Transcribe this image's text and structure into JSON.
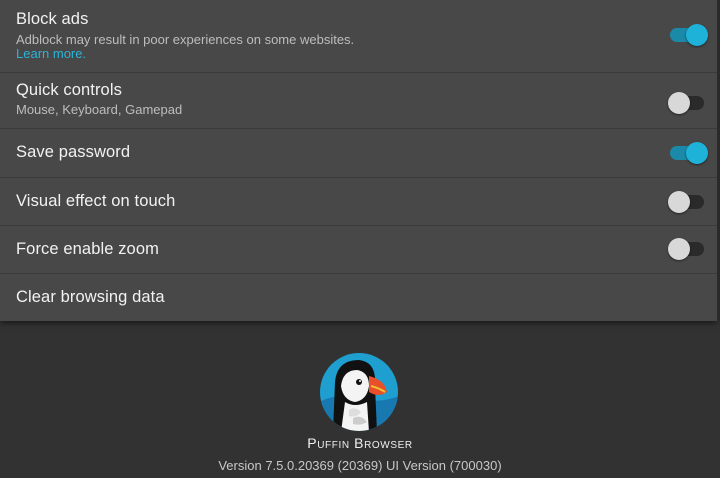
{
  "settings": {
    "block_ads": {
      "title": "Block ads",
      "subtitle": "Adblock may result in poor experiences on some websites.",
      "link": "Learn more.",
      "enabled": true
    },
    "quick_controls": {
      "title": "Quick controls",
      "subtitle": "Mouse, Keyboard, Gamepad",
      "enabled": false
    },
    "save_password": {
      "title": "Save password",
      "enabled": true
    },
    "visual_effect": {
      "title": "Visual effect on touch",
      "enabled": false
    },
    "force_zoom": {
      "title": "Force enable zoom",
      "enabled": false
    },
    "clear_data": {
      "title": "Clear browsing data"
    }
  },
  "about": {
    "app_name": "Puffin Browser",
    "version": "Version 7.5.0.20369 (20369) UI Version (700030)",
    "logo_icon": "puffin-bird-logo"
  },
  "colors": {
    "accent": "#1fb2d8",
    "link": "#2bb4d8",
    "panel_bg": "#484848",
    "page_bg": "#323232"
  }
}
